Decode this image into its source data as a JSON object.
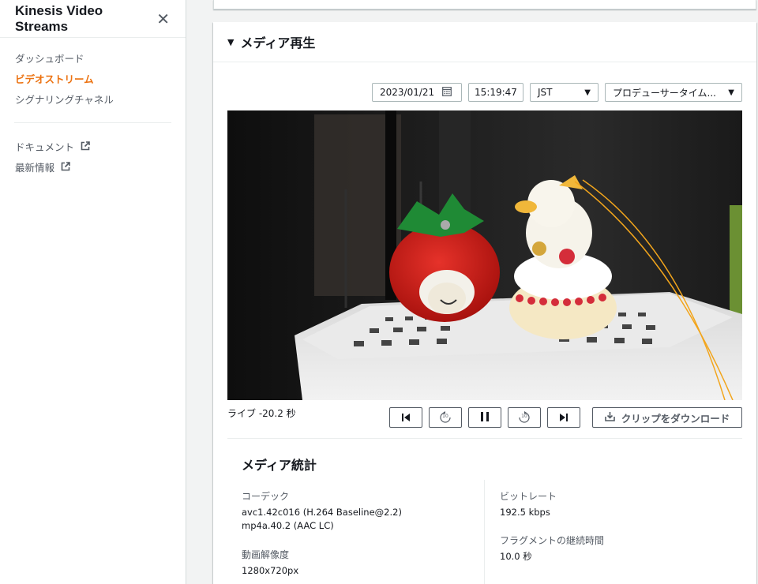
{
  "sidebar": {
    "title": "Kinesis Video Streams",
    "items": [
      {
        "label": "ダッシュボード",
        "active": false
      },
      {
        "label": "ビデオストリーム",
        "active": true
      },
      {
        "label": "シグナリングチャネル",
        "active": false
      }
    ],
    "links": [
      {
        "label": "ドキュメント",
        "icon": "external-link-icon"
      },
      {
        "label": "最新情報",
        "icon": "external-link-icon"
      }
    ]
  },
  "media_panel": {
    "title": "メディア再生",
    "date": "2023/01/21",
    "time": "15:19:47",
    "timezone": "JST",
    "timestamp_type": "プロデューサータイム...",
    "live_status": "ライブ -20.2 秒",
    "download_label": "クリップをダウンロード",
    "rewind_seconds": "10",
    "forward_seconds": "10"
  },
  "media_stats": {
    "title": "メディア統計",
    "codec_label": "コーデック",
    "codec_video": "avc1.42c016 (H.264 Baseline@2.2)",
    "codec_audio": "mp4a.40.2 (AAC LC)",
    "resolution_label": "動画解像度",
    "resolution_value": "1280x720px",
    "bitrate_label": "ビットレート",
    "bitrate_value": "192.5 kbps",
    "fragment_label": "フラグメントの継続時間",
    "fragment_value": "10.0 秒"
  },
  "colors": {
    "accent": "#ec7211",
    "text": "#16191f",
    "muted": "#545b64",
    "border": "#aab7b8"
  }
}
